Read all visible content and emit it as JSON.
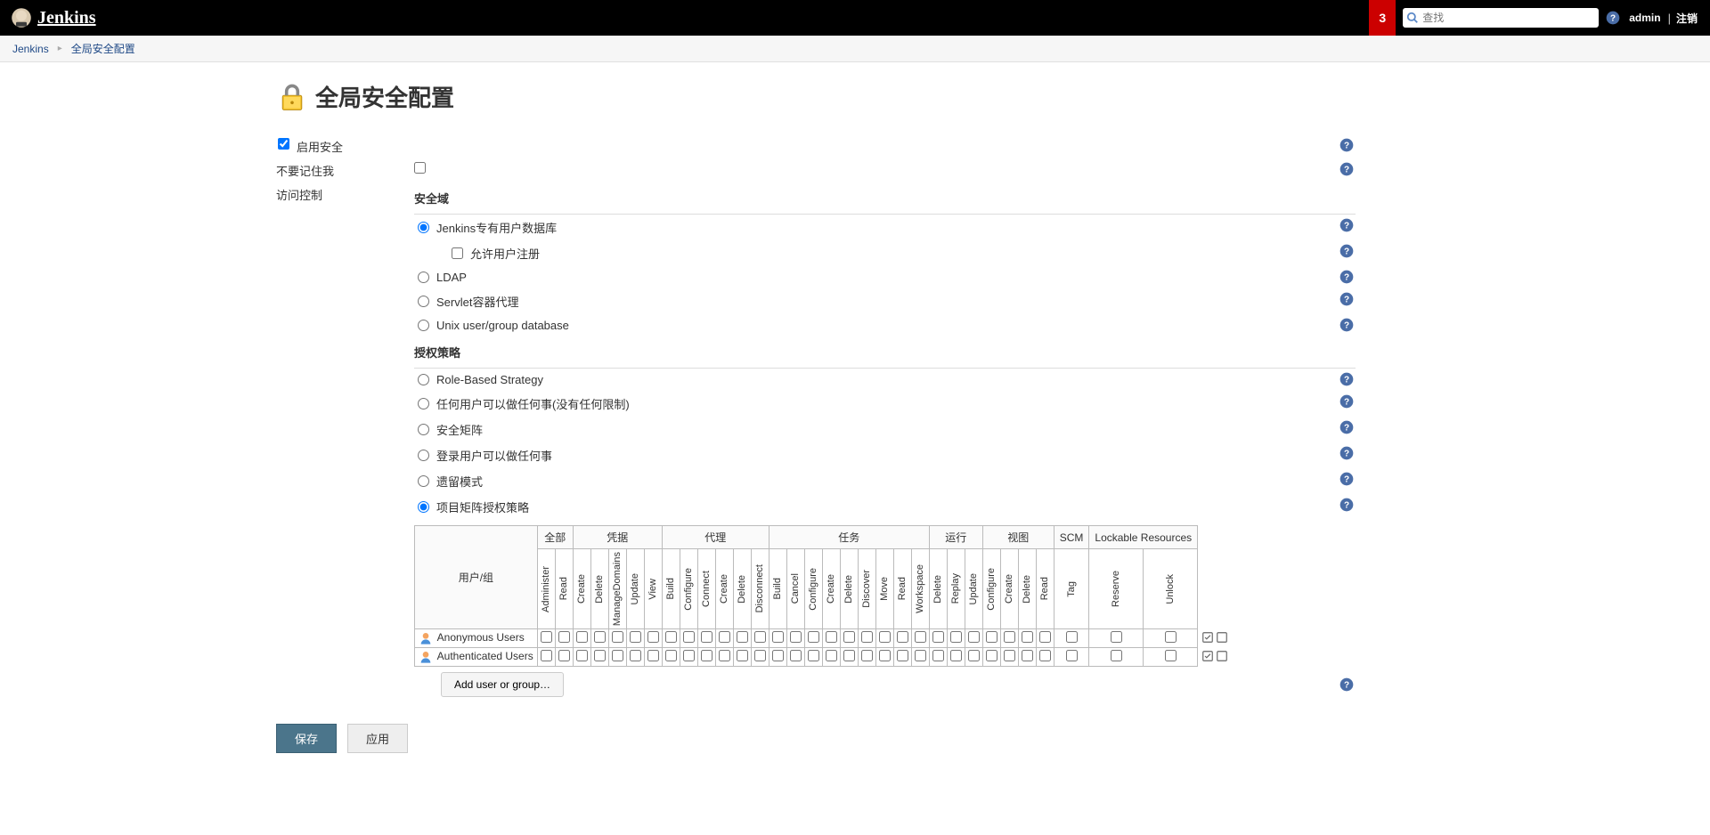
{
  "header": {
    "logo_text": "Jenkins",
    "notif_count": "3",
    "search_placeholder": "查找",
    "user": "admin",
    "logout": "注销"
  },
  "breadcrumb": {
    "items": [
      "Jenkins",
      "全局安全配置"
    ]
  },
  "page": {
    "title": "全局安全配置",
    "enable_security_label": "启用安全",
    "dont_remember_label": "不要记住我",
    "access_control_label": "访问控制",
    "realm_title": "安全域",
    "realm_options": {
      "jenkins_db": "Jenkins专有用户数据库",
      "allow_signup": "允许用户注册",
      "ldap": "LDAP",
      "servlet": "Servlet容器代理",
      "unix": "Unix user/group database"
    },
    "authz_title": "授权策略",
    "authz_options": {
      "role_based": "Role-Based Strategy",
      "anyone": "任何用户可以做任何事(没有任何限制)",
      "sec_matrix": "安全矩阵",
      "loggedin": "登录用户可以做任何事",
      "legacy": "遗留模式",
      "project_matrix": "项目矩阵授权策略"
    },
    "matrix": {
      "usergroup_header": "用户/组",
      "groups": [
        {
          "name": "全部",
          "perms": [
            "Administer",
            "Read"
          ]
        },
        {
          "name": "凭据",
          "perms": [
            "Create",
            "Delete",
            "ManageDomains",
            "Update",
            "View"
          ]
        },
        {
          "name": "代理",
          "perms": [
            "Build",
            "Configure",
            "Connect",
            "Create",
            "Delete",
            "Disconnect"
          ]
        },
        {
          "name": "任务",
          "perms": [
            "Build",
            "Cancel",
            "Configure",
            "Create",
            "Delete",
            "Discover",
            "Move",
            "Read",
            "Workspace"
          ]
        },
        {
          "name": "运行",
          "perms": [
            "Delete",
            "Replay",
            "Update"
          ]
        },
        {
          "name": "视图",
          "perms": [
            "Configure",
            "Create",
            "Delete",
            "Read"
          ]
        },
        {
          "name": "SCM",
          "perms": [
            "Tag"
          ]
        },
        {
          "name": "Lockable Resources",
          "perms": [
            "Reserve",
            "Unlock"
          ]
        }
      ],
      "rows": [
        {
          "label": "Anonymous Users"
        },
        {
          "label": "Authenticated Users"
        }
      ],
      "add_button": "Add user or group…"
    },
    "save_btn": "保存",
    "apply_btn": "应用"
  }
}
